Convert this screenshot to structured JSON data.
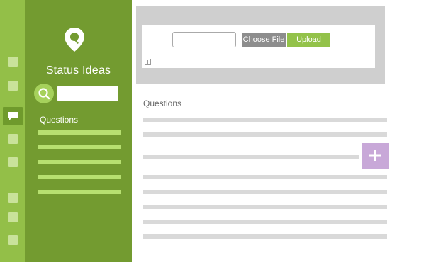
{
  "sidebar": {
    "app_title": "Status Ideas",
    "search": {
      "value": "",
      "placeholder": ""
    },
    "section_label": "Questions",
    "icons": {
      "logo": "map-pin-icon",
      "search": "search-icon",
      "active_rail_item": "chat-icon"
    }
  },
  "upload": {
    "file_value": "",
    "choose_file_label": "Choose File",
    "upload_label": "Upload"
  },
  "main": {
    "section_title": "Questions",
    "add_button_icon": "plus-icon"
  },
  "colors": {
    "rail": "#93bf48",
    "sidebar": "#739b30",
    "accent_green": "#93c24a",
    "add_button": "#c8a8d8"
  }
}
